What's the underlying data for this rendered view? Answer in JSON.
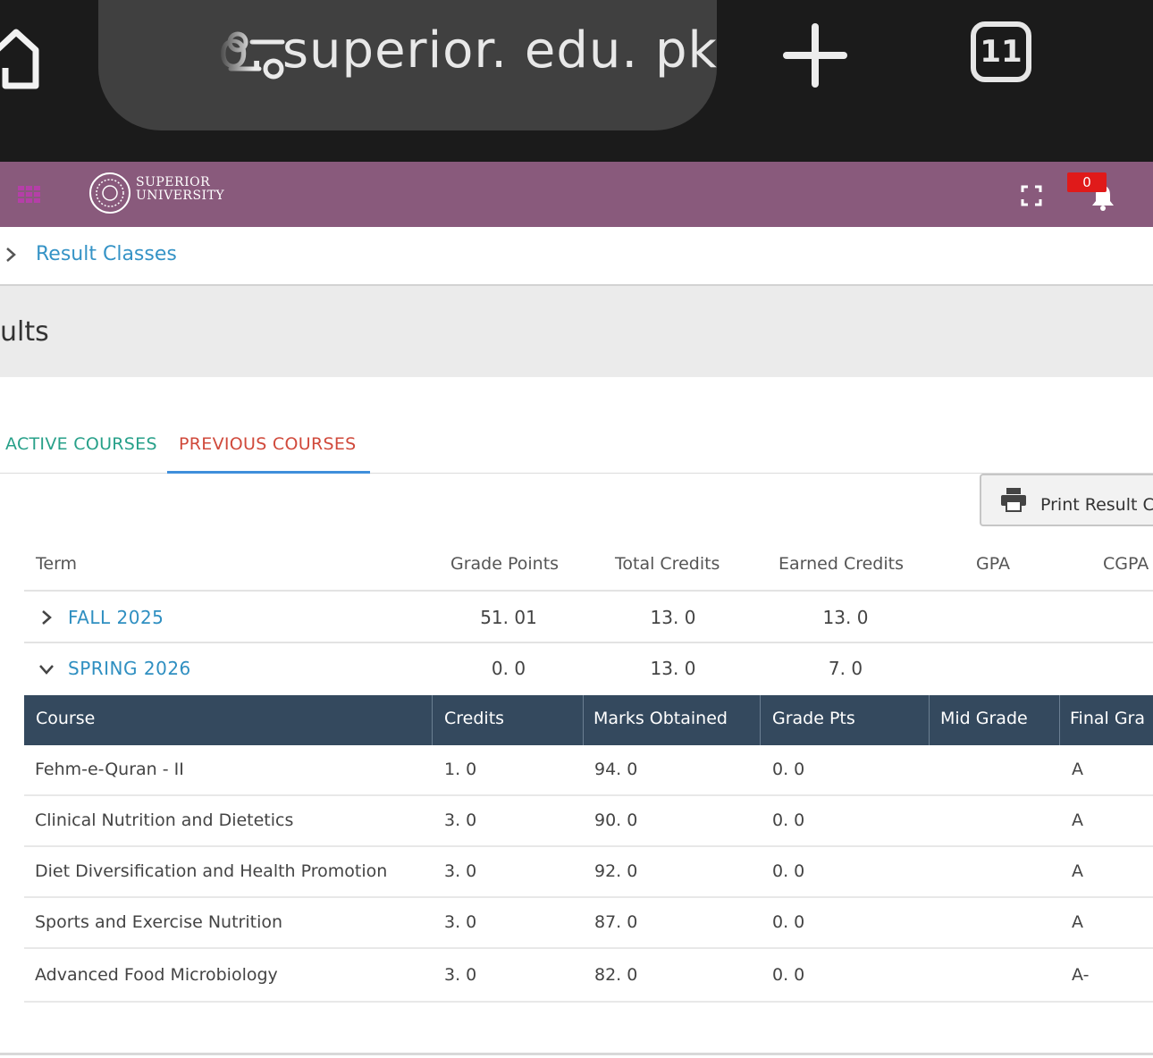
{
  "browser": {
    "url": "o. superior. edu. pk",
    "tab_count": "11"
  },
  "header": {
    "logo_line1": "SUPERIOR",
    "logo_line2": "UNIVERSITY",
    "notification_count": "0",
    "accent_color": "#895a7c"
  },
  "breadcrumb": {
    "label": "Result Classes"
  },
  "page": {
    "title": "ults"
  },
  "tabs": {
    "active_courses": "ACTIVE COURSES",
    "previous_courses": "PREVIOUS COURSES",
    "selected": "PREVIOUS COURSES"
  },
  "print_button": {
    "label": "Print Result C"
  },
  "summary": {
    "headers": {
      "term": "Term",
      "grade_points": "Grade Points",
      "total_credits": "Total Credits",
      "earned_credits": "Earned Credits",
      "gpa": "GPA",
      "cgpa": "CGPA"
    },
    "terms": [
      {
        "name": "FALL 2025",
        "expanded": false,
        "grade_points": "51. 01",
        "total_credits": "13. 0",
        "earned_credits": "13. 0"
      },
      {
        "name": "SPRING 2026",
        "expanded": true,
        "grade_points": "0. 0",
        "total_credits": "13. 0",
        "earned_credits": "7. 0"
      }
    ]
  },
  "courses": {
    "headers": {
      "course": "Course",
      "credits": "Credits",
      "marks": "Marks Obtained",
      "grade_pts": "Grade Pts",
      "mid_grade": "Mid Grade",
      "final_grade": "Final Gra"
    },
    "rows": [
      {
        "course": "Fehm-e-Quran - II",
        "credits": "1. 0",
        "marks": "94. 0",
        "grade_pts": "0. 0",
        "mid_grade": "",
        "final_grade": "A"
      },
      {
        "course": "Clinical Nutrition and Dietetics",
        "credits": "3. 0",
        "marks": "90. 0",
        "grade_pts": "0. 0",
        "mid_grade": "",
        "final_grade": "A"
      },
      {
        "course": "Diet Diversification and Health Promotion",
        "credits": "3. 0",
        "marks": "92. 0",
        "grade_pts": "0. 0",
        "mid_grade": "",
        "final_grade": "A"
      },
      {
        "course": "Sports and Exercise Nutrition",
        "credits": "3. 0",
        "marks": "87. 0",
        "grade_pts": "0. 0",
        "mid_grade": "",
        "final_grade": "A"
      },
      {
        "course": "Advanced Food Microbiology",
        "credits": "3. 0",
        "marks": "82. 0",
        "grade_pts": "0. 0",
        "mid_grade": "",
        "final_grade": "A-"
      }
    ]
  }
}
